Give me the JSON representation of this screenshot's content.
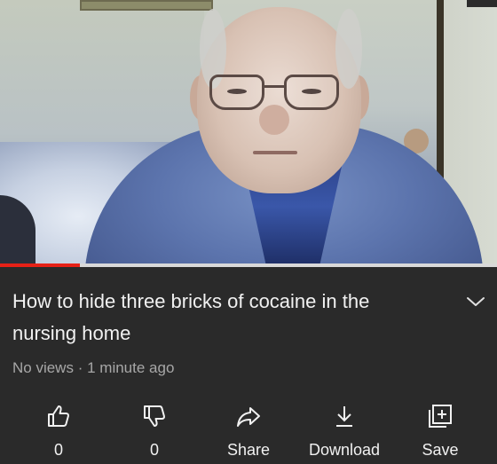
{
  "video": {
    "title": "How to hide three bricks of cocaine in the nursing home",
    "views": "No views",
    "separator": "·",
    "age": "1 minute ago",
    "progress_fraction": 0.16
  },
  "actions": {
    "like": {
      "label": "0",
      "icon": "thumbs-up-icon"
    },
    "dislike": {
      "label": "0",
      "icon": "thumbs-down-icon"
    },
    "share": {
      "label": "Share",
      "icon": "share-arrow-icon"
    },
    "download": {
      "label": "Download",
      "icon": "download-arrow-icon"
    },
    "save": {
      "label": "Save",
      "icon": "add-to-playlist-icon"
    }
  },
  "colors": {
    "background": "#2a2a2a",
    "progress": "#e62117",
    "meta_text": "#a7a7a7"
  }
}
